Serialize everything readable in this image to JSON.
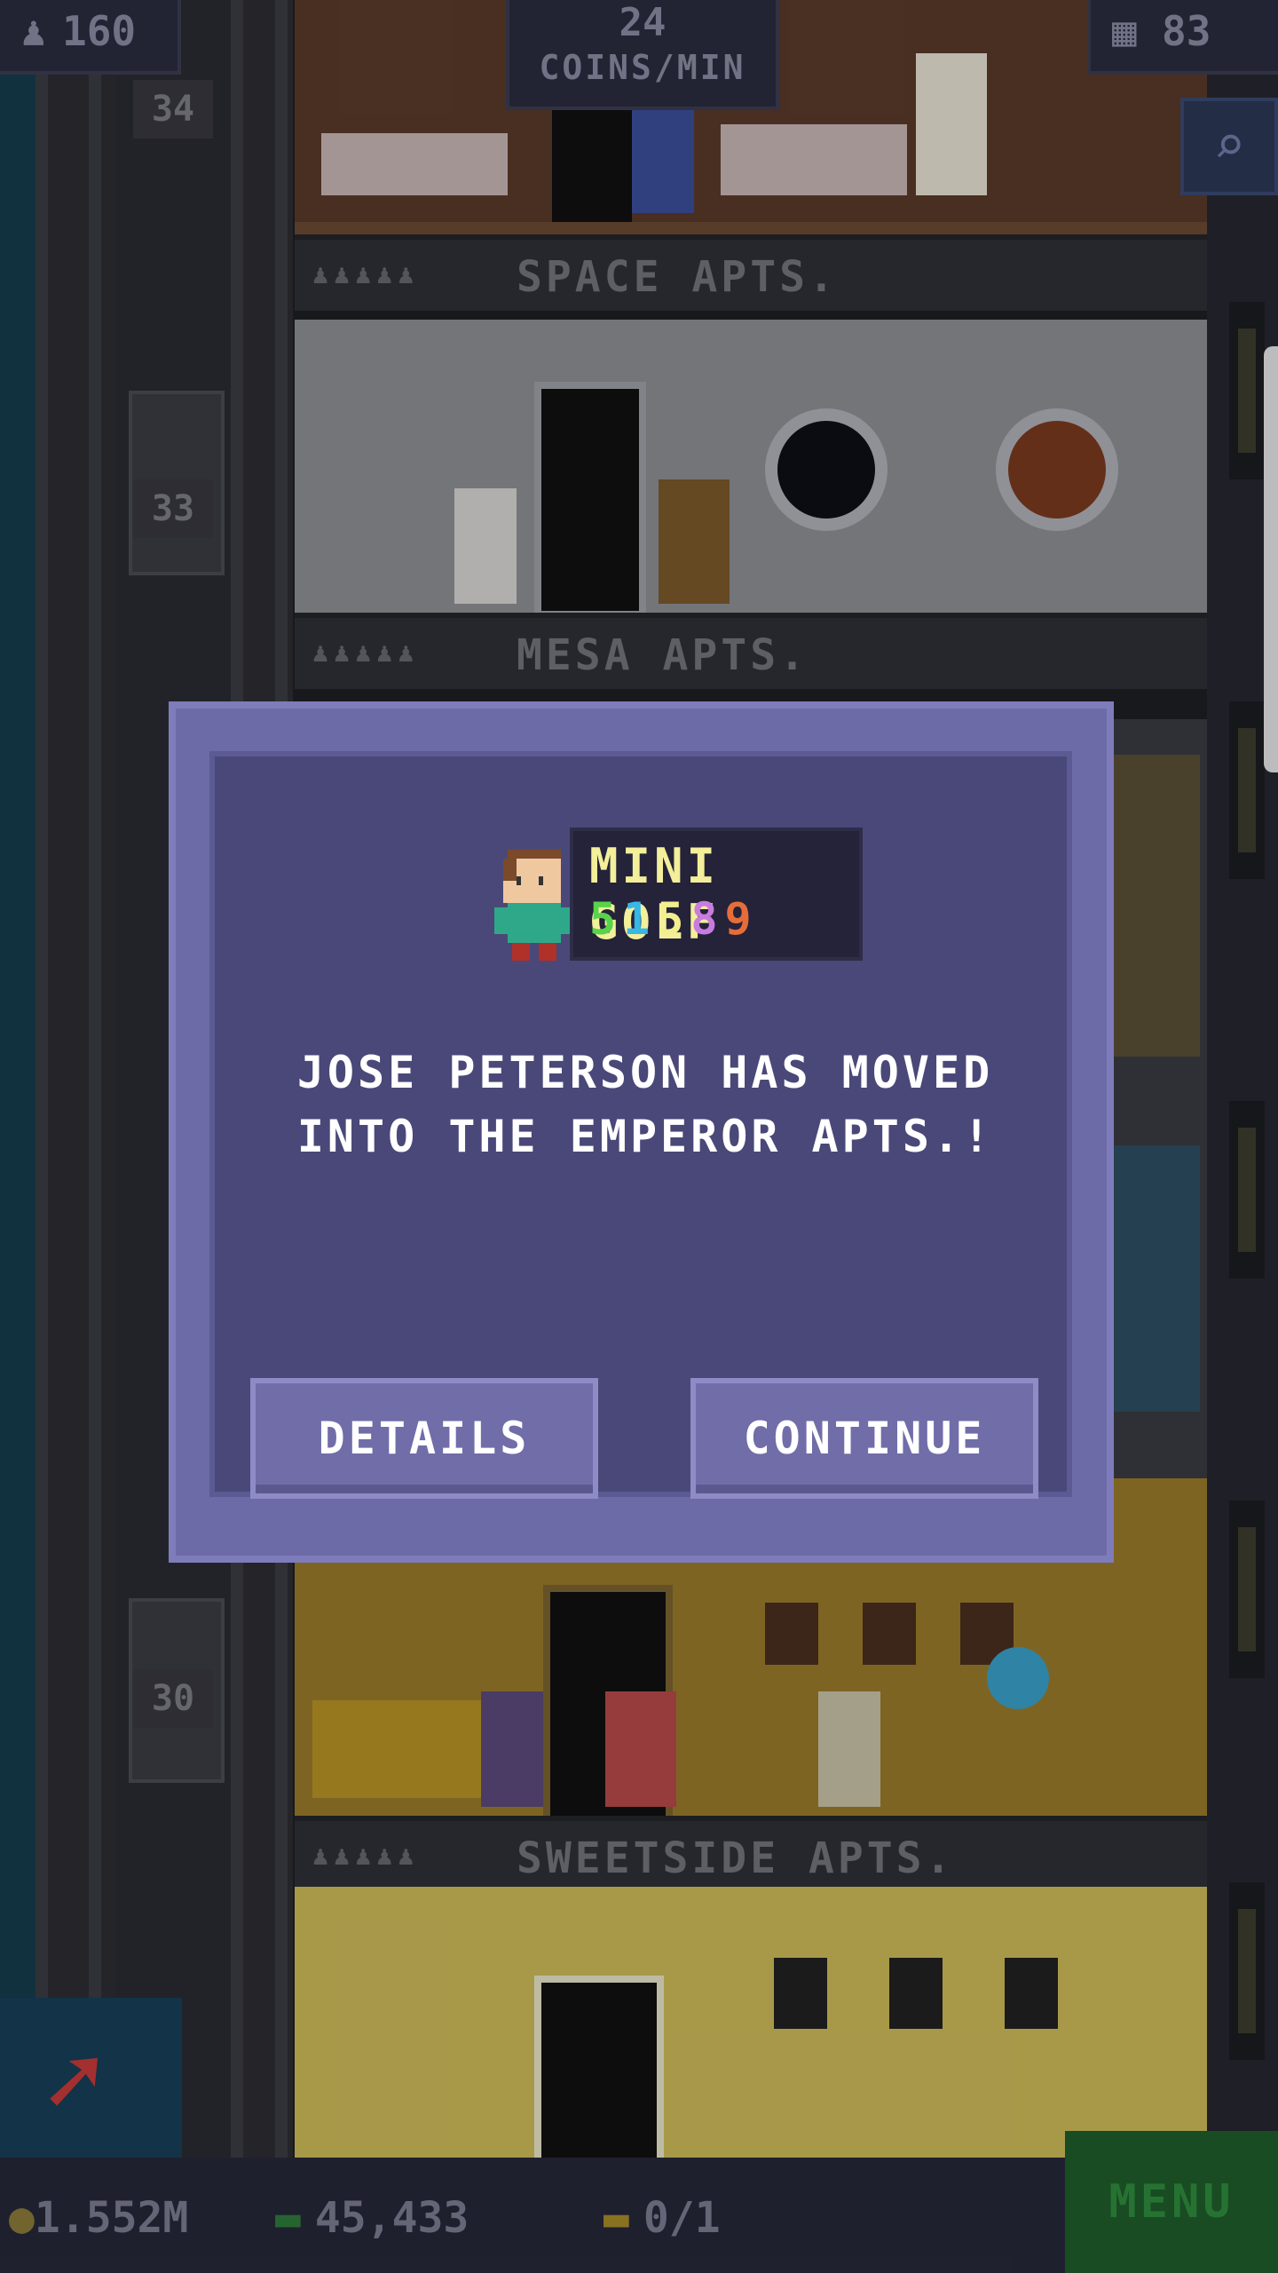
{
  "hud": {
    "population": "160",
    "coins_per_min_value": "24",
    "coins_per_min_label": "COINS/MIN",
    "floors": "83"
  },
  "floors": [
    {
      "number": "34",
      "sign": "SPACE APTS.",
      "dots": "♟♟♟♟♟"
    },
    {
      "number": "33",
      "sign": "MESA APTS.",
      "dots": "♟♟♟♟♟"
    },
    {
      "number": "30",
      "sign": "SWEETSIDE APTS.",
      "dots": "♟♟♟♟♟"
    }
  ],
  "dialog": {
    "skill_title": "MINI GOLF",
    "skill_digits": [
      "5",
      "1",
      "5",
      "8",
      "9"
    ],
    "skill_colors": [
      "#58d34a",
      "#37b7e6",
      "#f2ef8e",
      "#c97be0",
      "#e66d3a"
    ],
    "message_line1": "JOSE PETERSON HAS MOVED",
    "message_line2": "INTO THE EMPEROR APTS.!",
    "details_label": "DETAILS",
    "continue_label": "CONTINUE"
  },
  "bottom_bar": {
    "coins": "1.552M",
    "bux": "45,433",
    "tickets": "0/1",
    "menu_label": "MENU"
  }
}
